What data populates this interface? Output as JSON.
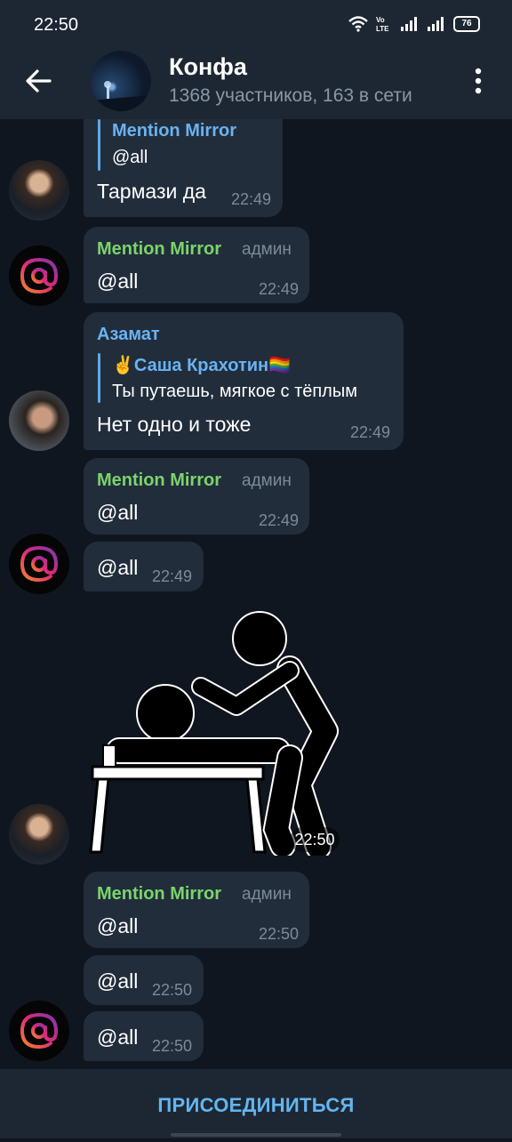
{
  "status_bar": {
    "time": "22:50",
    "battery": "76"
  },
  "header": {
    "title": "Конфа",
    "subtitle": "1368 участников, 163 в сети"
  },
  "colors": {
    "green_name": "#7bd46b",
    "blue_name": "#6ab2f2",
    "bubble": "#212d3b",
    "accent": "#64b5ef"
  },
  "messages": [
    {
      "quote_name": "Mention Mirror",
      "quote_text": "@all",
      "text": "Тармази да",
      "time": "22:49"
    },
    {
      "sender": "Mention Mirror",
      "role": "админ",
      "text": "@all",
      "time": "22:49"
    },
    {
      "sender": "Азамат",
      "quote_name": "✌️Саша Крахотин🏳️‍🌈",
      "quote_text": "Ты путаешь, мягкое с тёплым",
      "text": "Нет одно и тоже",
      "time": "22:49"
    },
    {
      "sender": "Mention Mirror",
      "role": "админ",
      "text": "@all",
      "time": "22:49"
    },
    {
      "text": "@all",
      "time": "22:49"
    },
    {
      "sticker_time": "22:50"
    },
    {
      "sender": "Mention Mirror",
      "role": "админ",
      "text": "@all",
      "time": "22:50"
    },
    {
      "text": "@all",
      "time": "22:50"
    },
    {
      "text": "@all",
      "time": "22:50"
    }
  ],
  "bottom": {
    "join_label": "ПРИСОЕДИНИТЬСЯ"
  },
  "icons": [
    "wifi-icon",
    "volte-icon",
    "signal-icon",
    "battery-icon",
    "back-arrow-icon",
    "more-vert-icon",
    "mention-icon"
  ]
}
